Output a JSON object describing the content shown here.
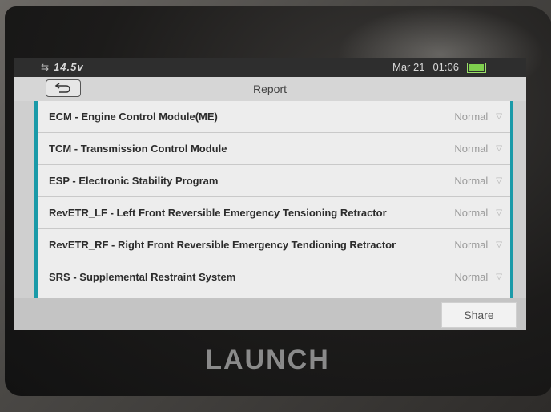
{
  "status": {
    "voltage": "14.5v",
    "date": "Mar 21",
    "time": "01:06"
  },
  "header": {
    "title": "Report",
    "back_icon": "back-arrow-icon"
  },
  "modules": [
    {
      "name": "ECM - Engine Control Module(ME)",
      "status": "Normal"
    },
    {
      "name": "TCM - Transmission Control Module",
      "status": "Normal"
    },
    {
      "name": "ESP - Electronic Stability Program",
      "status": "Normal"
    },
    {
      "name": "RevETR_LF - Left Front Reversible Emergency Tensioning Retractor",
      "status": "Normal"
    },
    {
      "name": "RevETR_RF - Right Front Reversible Emergency Tendioning Retractor",
      "status": "Normal"
    },
    {
      "name": "SRS - Supplemental Restraint System",
      "status": "Normal"
    }
  ],
  "footer": {
    "share_label": "Share"
  },
  "device": {
    "brand": "LAUNCH"
  },
  "colors": {
    "accent": "#1a9aa8",
    "battery": "#7fd04e"
  }
}
